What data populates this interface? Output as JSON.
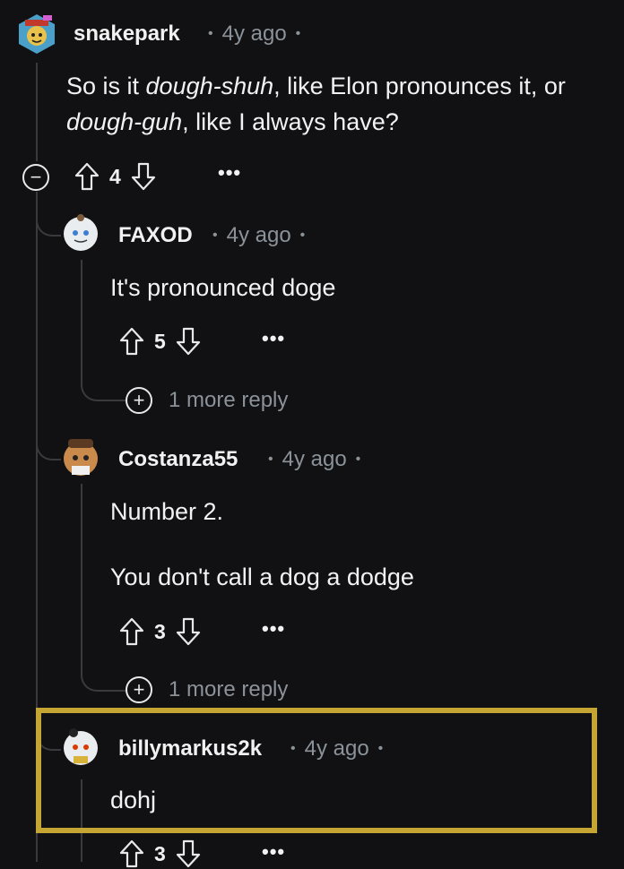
{
  "comments": [
    {
      "user": "snakepark",
      "age": "4y ago",
      "body": {
        "line1_pre": "So is it ",
        "line1_italic": "dough-shuh",
        "line1_post": ", like Elon pronounces it, or",
        "line2_italic": "dough-guh",
        "line2_post": ", like I always have?"
      },
      "votes": "4"
    },
    {
      "user": "FAXOD",
      "age": "4y ago",
      "body": "It's pronounced doge",
      "votes": "5",
      "more_replies": "1 more reply"
    },
    {
      "user": "Costanza55",
      "age": "4y ago",
      "body_line1": "Number 2.",
      "body_line2": "You don't call a dog a dodge",
      "votes": "3",
      "more_replies": "1 more reply"
    },
    {
      "user": "billymarkus2k",
      "age": "4y ago",
      "body": "dohj",
      "votes": "3"
    }
  ],
  "colors": {
    "background": "#111113",
    "highlight": "#c5a533",
    "meta": "#8b9299",
    "thread_line": "#3a3a3e"
  },
  "icons": [
    "collapse-icon",
    "upvote-icon",
    "downvote-icon",
    "more-options-icon",
    "expand-replies-icon"
  ]
}
